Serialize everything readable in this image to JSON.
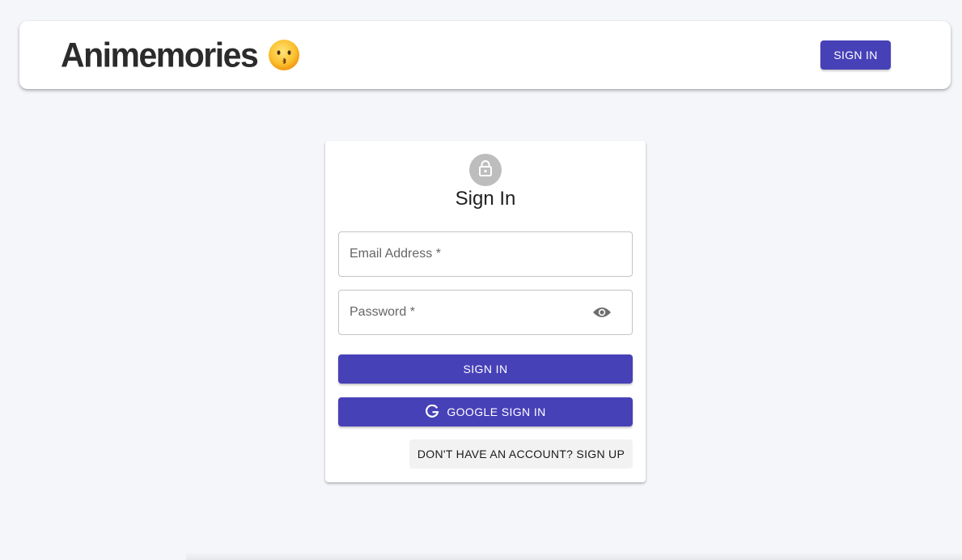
{
  "header": {
    "brand": "Animemories",
    "brand_emoji": "kissing-face-emoji",
    "signin_label": "SIGN IN"
  },
  "signin_card": {
    "avatar_icon": "lock-icon",
    "title": "Sign In",
    "email_label": "Email Address *",
    "email_value": "",
    "password_label": "Password *",
    "password_value": "",
    "password_toggle_icon": "eye-icon",
    "signin_button": "SIGN IN",
    "google_button": "GOOGLE SIGN IN",
    "google_icon": "google-g-icon",
    "signup_link": "DON'T HAVE AN ACCOUNT? SIGN UP"
  },
  "colors": {
    "background": "#f5f6fa",
    "primary": "#4741b8",
    "avatar": "#bdbdbd",
    "surface": "#ffffff"
  }
}
